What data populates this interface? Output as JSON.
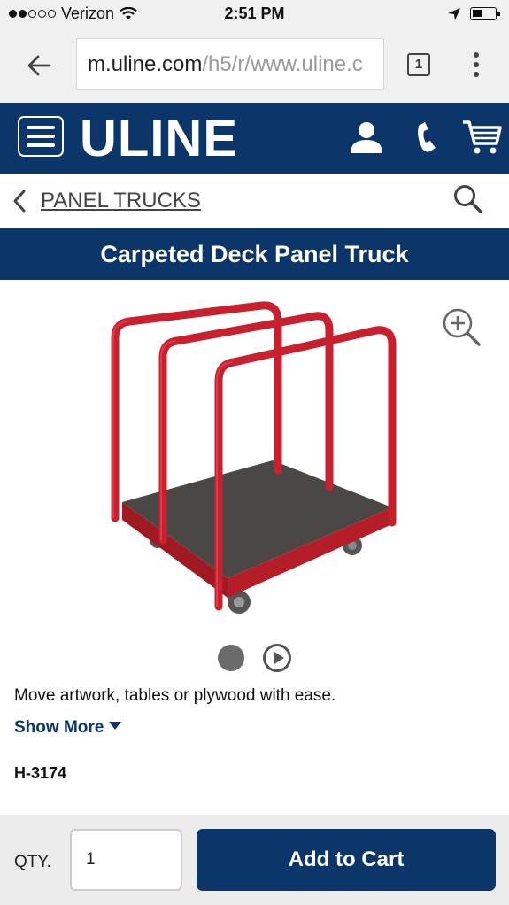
{
  "status_bar": {
    "carrier": "Verizon",
    "time": "2:51 PM"
  },
  "browser": {
    "url_host": "m.uline.com",
    "url_path": "/h5/r/www.uline.c",
    "tab_count": "1"
  },
  "header": {
    "logo_text": "ULINE"
  },
  "breadcrumb": {
    "label": "PANEL TRUCKS"
  },
  "product": {
    "title": "Carpeted Deck Panel Truck",
    "description": "Move artwork, tables or plywood with ease.",
    "show_more_label": "Show More",
    "sku": "H-3174"
  },
  "cart_bar": {
    "qty_label": "QTY.",
    "qty_value": "1",
    "add_to_cart_label": "Add to Cart"
  },
  "colors": {
    "brand_navy": "#0c356a",
    "frame_red": "#c8202e",
    "deck_gray": "#4a4744"
  }
}
